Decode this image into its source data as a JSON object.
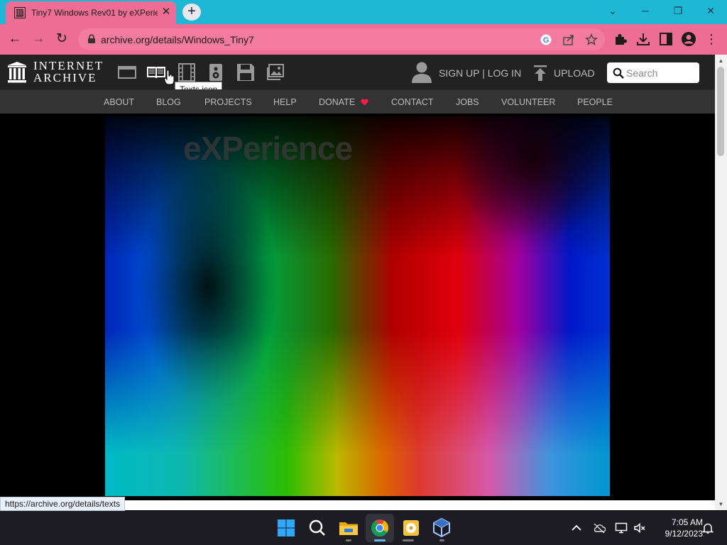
{
  "browser": {
    "tab_title": "Tiny7 Windows Rev01 by eXPerie",
    "tab_close": "✕",
    "new_tab": "+",
    "url": "archive.org/details/Windows_Tiny7",
    "back": "←",
    "forward": "→",
    "reload": "↻",
    "window_min": "─",
    "window_restore": "❐",
    "window_close": "✕",
    "window_chevron": "⌄",
    "menu": "⋮"
  },
  "ia": {
    "logo_line1": "INTERNET",
    "logo_line2": "ARCHIVE",
    "tooltip": "Texts icon",
    "signup": "SIGN UP | LOG IN",
    "upload": "UPLOAD",
    "search_placeholder": "Search",
    "nav": {
      "about": "ABOUT",
      "blog": "BLOG",
      "projects": "PROJECTS",
      "help": "HELP",
      "donate": "DONATE",
      "contact": "CONTACT",
      "jobs": "JOBS",
      "volunteer": "VOLUNTEER",
      "people": "PEOPLE"
    },
    "donate_color": "#ff1a4a"
  },
  "content": {
    "watermark": "eXPerience"
  },
  "status_url": "https://archive.org/details/texts",
  "taskbar": {
    "time": "7:05 AM",
    "date": "9/12/2023"
  },
  "colors": {
    "tabstrip": "#1fb7d6",
    "toolbar": "#ee6d95",
    "ia_header": "#222222",
    "ia_nav": "#333333"
  }
}
